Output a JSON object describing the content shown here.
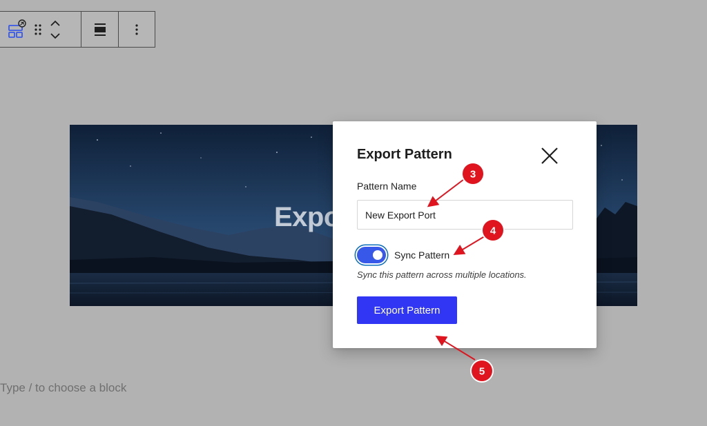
{
  "toolbar": {
    "buttons": [
      {
        "name": "pattern-block-icon"
      },
      {
        "name": "drag-handle-icon"
      },
      {
        "name": "move-up-down-icon"
      },
      {
        "name": "align-icon"
      },
      {
        "name": "more-options-icon"
      }
    ]
  },
  "cover": {
    "title": "Expo"
  },
  "editor": {
    "placeholder": "Type / to choose a block"
  },
  "modal": {
    "title": "Export Pattern",
    "field_label": "Pattern Name",
    "field_value": "New Export Port",
    "toggle_label": "Sync Pattern",
    "toggle_on": true,
    "help_text": "Sync this pattern across multiple locations.",
    "submit_label": "Export Pattern"
  },
  "annotations": [
    {
      "number": "3"
    },
    {
      "number": "4"
    },
    {
      "number": "5"
    }
  ],
  "colors": {
    "backdrop": "#b2b2b2",
    "primary": "#3036f4",
    "toggle": "#3858e9",
    "annotation": "#e0141e"
  }
}
